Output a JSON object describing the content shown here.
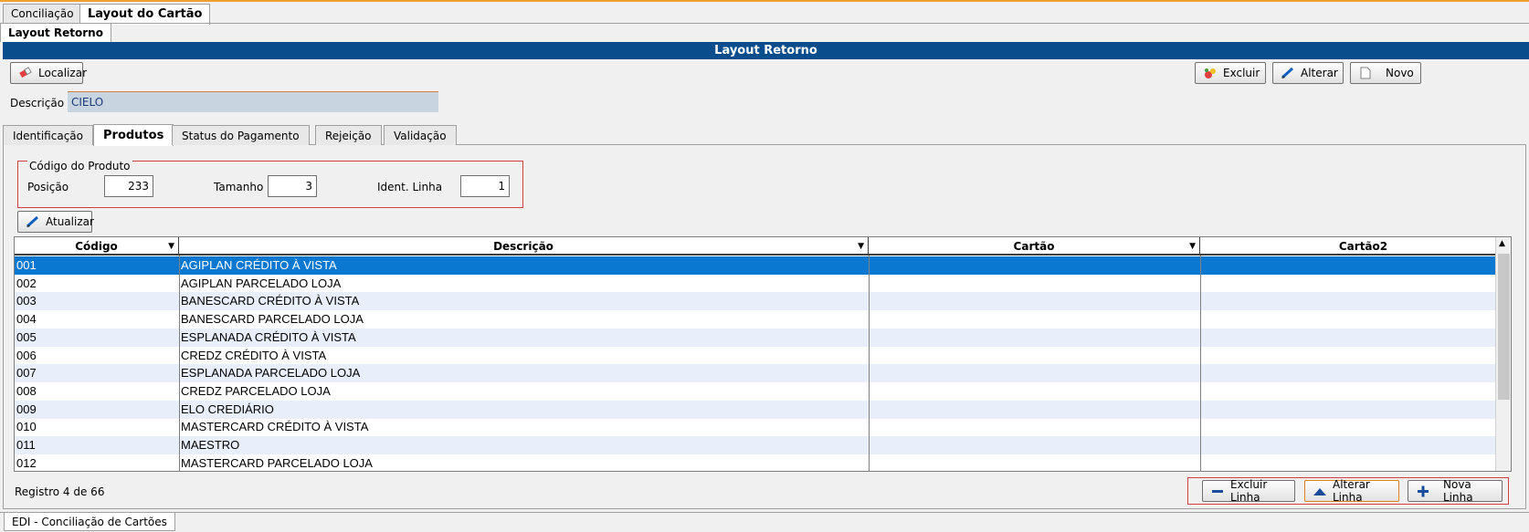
{
  "top_tabs": [
    "Conciliação",
    "Layout do Cartão"
  ],
  "sub_tab": "Layout Retorno",
  "title": "Layout Retorno",
  "toolbar": {
    "localizar": "Localizar",
    "excluir": "Excluir",
    "alterar": "Alterar",
    "novo": "Novo"
  },
  "descricao": {
    "label": "Descrição",
    "value": "CIELO"
  },
  "detail_tabs": [
    "Identificação",
    "Produtos",
    "Status do Pagamento",
    "Rejeição",
    "Validação"
  ],
  "active_detail_tab": "Produtos",
  "codigo_produto": {
    "title": "Código do Produto",
    "posicao_label": "Posição",
    "posicao_value": "233",
    "tamanho_label": "Tamanho",
    "tamanho_value": "3",
    "ident_linha_label": "Ident. Linha",
    "ident_linha_value": "1"
  },
  "atualizar": "Atualizar",
  "grid": {
    "columns": [
      "Código",
      "Descrição",
      "Cartão",
      "Cartão2"
    ],
    "rows": [
      {
        "codigo": "001",
        "descricao": "AGIPLAN CRÉDITO À VISTA",
        "cartao": "",
        "cartao2": ""
      },
      {
        "codigo": "002",
        "descricao": "AGIPLAN PARCELADO LOJA",
        "cartao": "",
        "cartao2": ""
      },
      {
        "codigo": "003",
        "descricao": "BANESCARD CRÉDITO À VISTA",
        "cartao": "",
        "cartao2": ""
      },
      {
        "codigo": "004",
        "descricao": "BANESCARD PARCELADO LOJA",
        "cartao": "",
        "cartao2": ""
      },
      {
        "codigo": "005",
        "descricao": "ESPLANADA CRÉDITO À VISTA",
        "cartao": "",
        "cartao2": ""
      },
      {
        "codigo": "006",
        "descricao": "CREDZ CRÉDITO À VISTA",
        "cartao": "",
        "cartao2": ""
      },
      {
        "codigo": "007",
        "descricao": "ESPLANADA PARCELADO LOJA",
        "cartao": "",
        "cartao2": ""
      },
      {
        "codigo": "008",
        "descricao": "CREDZ PARCELADO LOJA",
        "cartao": "",
        "cartao2": ""
      },
      {
        "codigo": "009",
        "descricao": "ELO CREDIÁRIO",
        "cartao": "",
        "cartao2": ""
      },
      {
        "codigo": "010",
        "descricao": "MASTERCARD CRÉDITO À VISTA",
        "cartao": "",
        "cartao2": ""
      },
      {
        "codigo": "011",
        "descricao": "MAESTRO",
        "cartao": "",
        "cartao2": ""
      },
      {
        "codigo": "012",
        "descricao": "MASTERCARD PARCELADO LOJA",
        "cartao": "",
        "cartao2": ""
      }
    ],
    "selected_index": 0
  },
  "registro": "Registro 4 de 66",
  "line_actions": {
    "excluir_linha": "Excluir Linha",
    "alterar_linha": "Alterar Linha",
    "nova_linha": "Nova Linha"
  },
  "status_tab": "EDI - Conciliação de Cartões",
  "colors": {
    "title_bar": "#0a4d8c",
    "selection": "#0a78d0",
    "alt_row": "#e8eefa",
    "highlight_border": "#d04040"
  }
}
